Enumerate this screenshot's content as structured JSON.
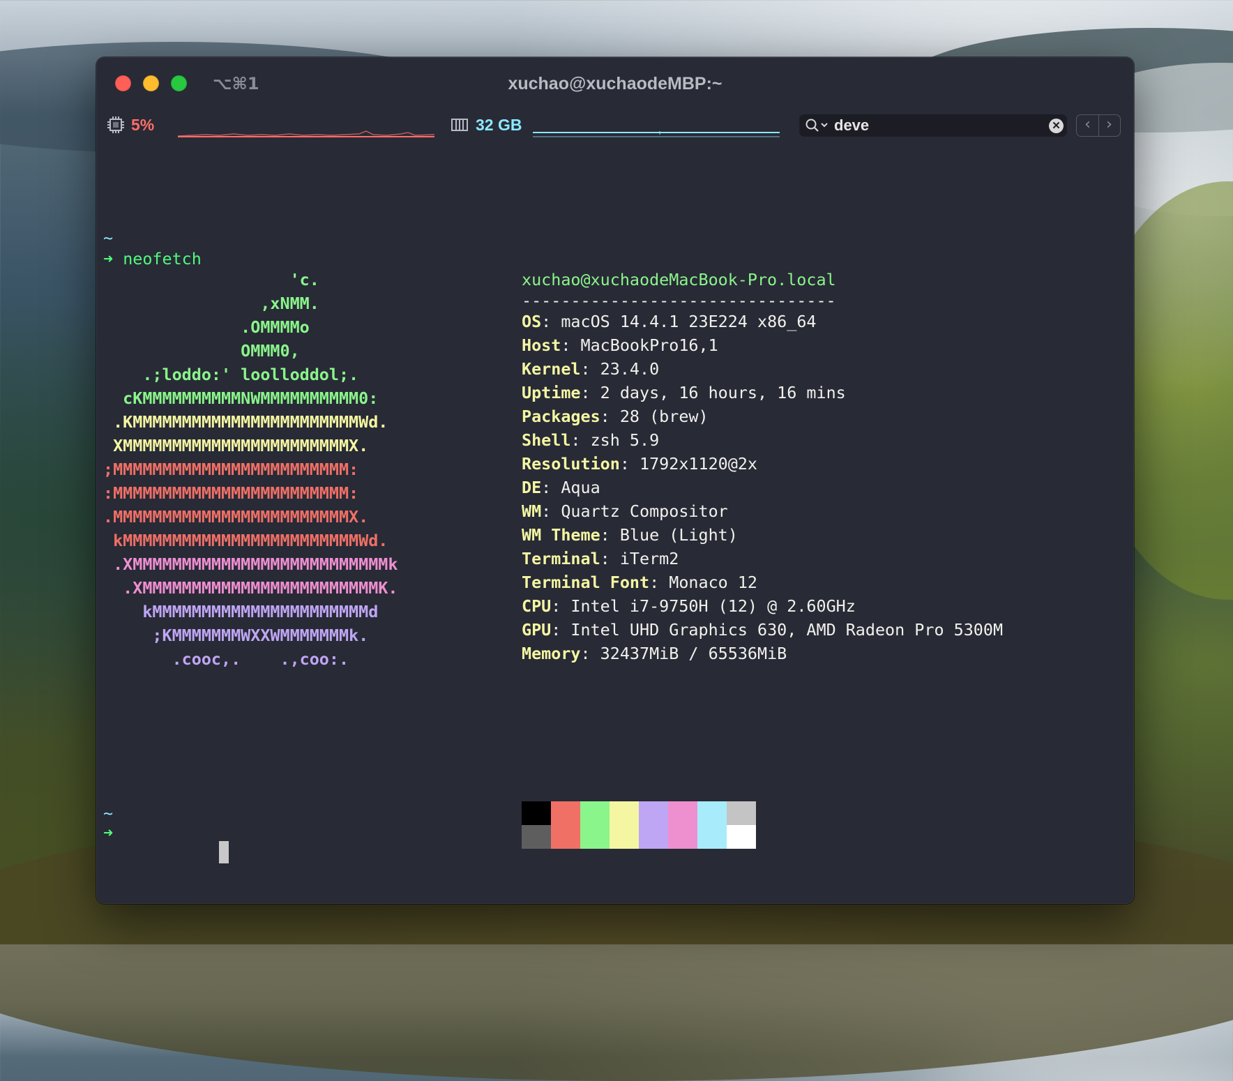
{
  "window": {
    "shortcut": "⌥⌘1",
    "title": "xuchao@xuchaodeMBP:~"
  },
  "status": {
    "cpu": "5%",
    "memory": "32 GB",
    "search_value": "deve"
  },
  "terminal": {
    "prompt_dir": "~",
    "prompt_arrow": "➜",
    "command": "neofetch",
    "logo": [
      {
        "text": "                   'c.",
        "color": "g"
      },
      {
        "text": "                ,xNMM.",
        "color": "g"
      },
      {
        "text": "              .OMMMMo",
        "color": "g"
      },
      {
        "text": "              OMMM0,",
        "color": "g"
      },
      {
        "text": "    .;loddo:' loolloddol;.",
        "color": "g"
      },
      {
        "text": "  cKMMMMMMMMMMNWMMMMMMMMMM0:",
        "color": "g"
      },
      {
        "text": " .KMMMMMMMMMMMMMMMMMMMMMMMWd.",
        "color": "y"
      },
      {
        "text": " XMMMMMMMMMMMMMMMMMMMMMMMX.",
        "color": "y"
      },
      {
        "text": ";MMMMMMMMMMMMMMMMMMMMMMMM:",
        "color": "r"
      },
      {
        "text": ":MMMMMMMMMMMMMMMMMMMMMMMM:",
        "color": "r"
      },
      {
        "text": ".MMMMMMMMMMMMMMMMMMMMMMMMX.",
        "color": "r"
      },
      {
        "text": " kMMMMMMMMMMMMMMMMMMMMMMMMWd.",
        "color": "r"
      },
      {
        "text": " .XMMMMMMMMMMMMMMMMMMMMMMMMMMk",
        "color": "m"
      },
      {
        "text": "  .XMMMMMMMMMMMMMMMMMMMMMMMMK.",
        "color": "m"
      },
      {
        "text": "    kMMMMMMMMMMMMMMMMMMMMMMd",
        "color": "b"
      },
      {
        "text": "     ;KMMMMMMMWXXWMMMMMMMk.",
        "color": "b"
      },
      {
        "text": "       .cooc,.    .,coo:.",
        "color": "b"
      }
    ],
    "header": "xuchao@xuchaodeMacBook-Pro.local",
    "separator": "--------------------------------",
    "info": [
      {
        "key": "OS",
        "value": "macOS 14.4.1 23E224 x86_64"
      },
      {
        "key": "Host",
        "value": "MacBookPro16,1"
      },
      {
        "key": "Kernel",
        "value": "23.4.0"
      },
      {
        "key": "Uptime",
        "value": "2 days, 16 hours, 16 mins"
      },
      {
        "key": "Packages",
        "value": "28 (brew)"
      },
      {
        "key": "Shell",
        "value": "zsh 5.9"
      },
      {
        "key": "Resolution",
        "value": "1792x1120@2x"
      },
      {
        "key": "DE",
        "value": "Aqua"
      },
      {
        "key": "WM",
        "value": "Quartz Compositor"
      },
      {
        "key": "WM Theme",
        "value": "Blue (Light)"
      },
      {
        "key": "Terminal",
        "value": "iTerm2"
      },
      {
        "key": "Terminal Font",
        "value": "Monaco 12"
      },
      {
        "key": "CPU",
        "value": "Intel i7-9750H (12) @ 2.60GHz"
      },
      {
        "key": "GPU",
        "value": "Intel UHD Graphics 630, AMD Radeon Pro 5300M"
      },
      {
        "key": "Memory",
        "value": "32437MiB / 65536MiB"
      }
    ],
    "palette_top": [
      "#000000",
      "#f07066",
      "#8af58a",
      "#f4f6a2",
      "#bfa6f4",
      "#ee8fd0",
      "#a8ecfb",
      "#c4c4c4"
    ],
    "palette_bottom": [
      "#5e5e5e",
      "#f07066",
      "#8af58a",
      "#f4f6a2",
      "#bfa6f4",
      "#ee8fd0",
      "#a8ecfb",
      "#ffffff"
    ]
  }
}
